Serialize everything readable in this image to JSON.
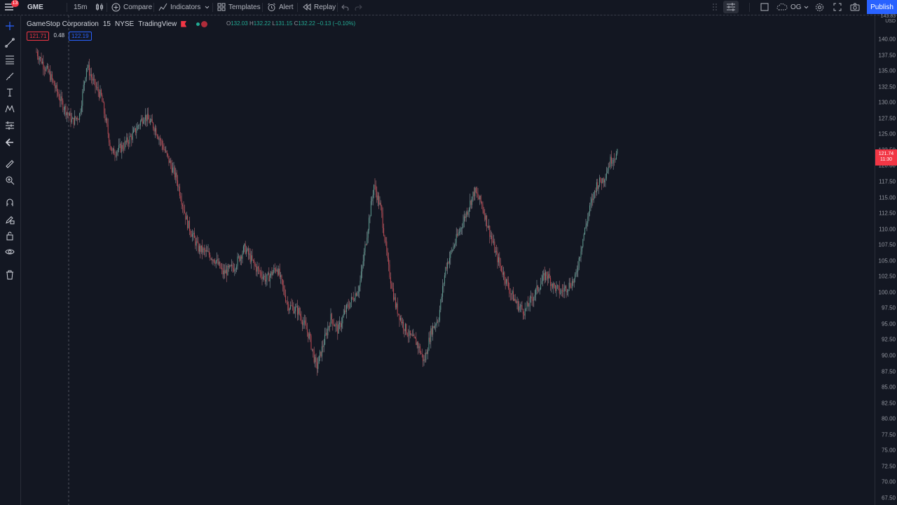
{
  "app": {
    "symbol": "GME",
    "interval": "15m",
    "notifications": "13",
    "publish_label": "Publish"
  },
  "toolbar": {
    "compare_label": "Compare",
    "indicators_label": "Indicators",
    "templates_label": "Templates",
    "alert_label": "Alert",
    "replay_label": "Replay",
    "layout_label": "OG"
  },
  "legend": {
    "company": "GameStop Corporation",
    "interval": "15",
    "exchange": "NYSE",
    "source": "TradingView",
    "open_label": "O",
    "open_value": "132.03",
    "high_label": "H",
    "high_value": "132.22",
    "low_label": "L",
    "low_value": "131.15",
    "close_label": "C",
    "close_value": "132.22",
    "change": "−0.13 (−0.10%)",
    "bid": "121.71",
    "spread": "0.48",
    "ask": "122.19"
  },
  "price_axis": {
    "currency": "USD",
    "top_label": "143.83",
    "ticks": [
      "140.00",
      "137.50",
      "135.00",
      "132.50",
      "130.00",
      "127.50",
      "125.00",
      "122.50",
      "120.00",
      "117.50",
      "115.00",
      "112.50",
      "110.00",
      "107.50",
      "105.00",
      "102.50",
      "100.00",
      "97.50",
      "95.00",
      "92.50",
      "90.00",
      "87.50",
      "85.00",
      "82.50",
      "80.00",
      "77.50",
      "75.00",
      "72.50",
      "70.00",
      "67.50"
    ],
    "last_price": "121.74",
    "countdown": "11:30"
  },
  "colors": {
    "background": "#131722",
    "up": "#22ab94",
    "down": "#f23645",
    "accent": "#2962ff"
  },
  "icons": [
    "menu-icon",
    "bar-style-icon",
    "plus-circle-icon",
    "indicators-icon",
    "templates-icon",
    "alert-icon",
    "replay-icon",
    "undo-icon",
    "redo-icon",
    "layout-icon",
    "square-icon",
    "cloud-icon",
    "gear-icon",
    "fullscreen-icon",
    "camera-icon",
    "crosshair-icon",
    "trendline-icon",
    "fib-icon",
    "brush-icon",
    "text-icon",
    "pattern-icon",
    "forecast-icon",
    "back-arrow-icon",
    "ruler-icon",
    "zoom-icon",
    "magnet-icon",
    "lock-pencil-icon",
    "lock-icon",
    "eye-icon",
    "trash-icon"
  ],
  "chart_data": {
    "type": "candlestick",
    "symbol": "GME",
    "interval": "15",
    "ylim": [
      67.5,
      143.83
    ],
    "grid": false,
    "price_path": [
      [
        0,
        138
      ],
      [
        4,
        134
      ],
      [
        7,
        130
      ],
      [
        10,
        127
      ],
      [
        12,
        128
      ],
      [
        14,
        136
      ],
      [
        16,
        133
      ],
      [
        18,
        131
      ],
      [
        21,
        122
      ],
      [
        24,
        123
      ],
      [
        27,
        125
      ],
      [
        30,
        128
      ],
      [
        33,
        126
      ],
      [
        36,
        122
      ],
      [
        39,
        118
      ],
      [
        42,
        111
      ],
      [
        45,
        107
      ],
      [
        48,
        106
      ],
      [
        50,
        105
      ],
      [
        52,
        103
      ],
      [
        55,
        104
      ],
      [
        58,
        107
      ],
      [
        61,
        104
      ],
      [
        64,
        102
      ],
      [
        67,
        104
      ],
      [
        70,
        98
      ],
      [
        73,
        97
      ],
      [
        76,
        93
      ],
      [
        78,
        88
      ],
      [
        80,
        92
      ],
      [
        82,
        96
      ],
      [
        84,
        94
      ],
      [
        86,
        97
      ],
      [
        88,
        99
      ],
      [
        90,
        101
      ],
      [
        92,
        109
      ],
      [
        94,
        117
      ],
      [
        96,
        113
      ],
      [
        98,
        104
      ],
      [
        100,
        98
      ],
      [
        102,
        95
      ],
      [
        104,
        93
      ],
      [
        106,
        92
      ],
      [
        108,
        89
      ],
      [
        110,
        94
      ],
      [
        112,
        96
      ],
      [
        114,
        104
      ],
      [
        116,
        107
      ],
      [
        118,
        110
      ],
      [
        120,
        113
      ],
      [
        122,
        116
      ],
      [
        124,
        114
      ],
      [
        126,
        110
      ],
      [
        128,
        106
      ],
      [
        130,
        103
      ],
      [
        132,
        100
      ],
      [
        134,
        98
      ],
      [
        136,
        97
      ],
      [
        138,
        99
      ],
      [
        140,
        101
      ],
      [
        142,
        103
      ],
      [
        144,
        101
      ],
      [
        146,
        100
      ],
      [
        148,
        101
      ],
      [
        150,
        102
      ],
      [
        152,
        108
      ],
      [
        154,
        113
      ],
      [
        156,
        117
      ],
      [
        158,
        118
      ],
      [
        160,
        121
      ],
      [
        162,
        122
      ]
    ],
    "price_path_units": [
      "bar_index",
      "price"
    ]
  }
}
